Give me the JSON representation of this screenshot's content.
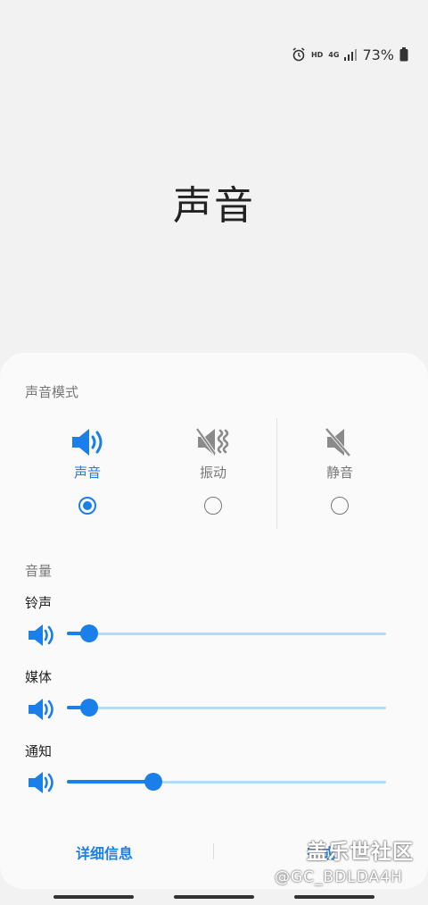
{
  "status_bar": {
    "icons": [
      "alarm-icon",
      "hd-icon",
      "4g-icon",
      "signal-icon",
      "battery-icon"
    ],
    "hd_text": "HD",
    "network_text": "4G",
    "battery_percent": "73%"
  },
  "page": {
    "title": "声音"
  },
  "sheet": {
    "mode_section_label": "声音模式",
    "modes": [
      {
        "label": "声音",
        "icon": "speaker-icon",
        "selected": true
      },
      {
        "label": "振动",
        "icon": "vibrate-muted-icon",
        "selected": false
      },
      {
        "label": "静音",
        "icon": "speaker-muted-icon",
        "selected": false
      }
    ],
    "volume_section_label": "音量",
    "volumes": [
      {
        "label": "铃声",
        "icon": "speaker-icon",
        "level": 0.07
      },
      {
        "label": "媒体",
        "icon": "speaker-icon",
        "level": 0.07
      },
      {
        "label": "通知",
        "icon": "speaker-icon",
        "level": 0.27
      }
    ],
    "footer": {
      "details_label": "详细信息",
      "done_label": "完成"
    }
  },
  "watermark": {
    "text": "盖乐世社区",
    "handle": "@GC_BDLDA4H"
  },
  "colors": {
    "accent": "#1a7fe8",
    "track": "#b3dbf6",
    "background": "#f2f2f2",
    "sheet": "#fafafa"
  }
}
